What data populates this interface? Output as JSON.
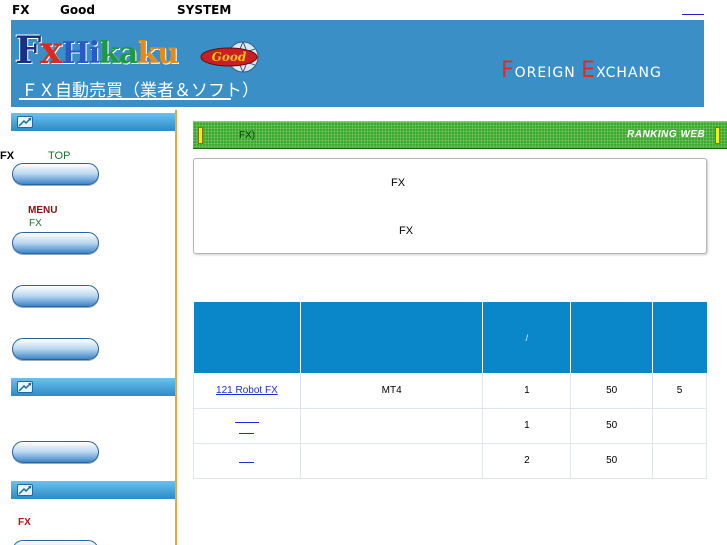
{
  "header": {
    "brand_left": "FX",
    "brand_mid": "Good",
    "brand_right": "SYSTEM"
  },
  "banner": {
    "logo_letters": [
      "F",
      "x",
      "Hi",
      "ka",
      "ku"
    ],
    "logo_badge": "Good",
    "logo_subtitle": "ＦＸ自動売買（業者＆ソフト）",
    "slogan_first_cap": "F",
    "slogan_first_rest": "OREIGN ",
    "slogan_second_cap": "E",
    "slogan_second_rest": "XCHANG"
  },
  "sidebar": {
    "fx_label": "FX",
    "top_label": "TOP",
    "menu_label": "MENU",
    "menu_sub": "FX",
    "bottom_label": "FX"
  },
  "main": {
    "ranking_title": "FX)",
    "ranking_tag": "RANKING WEB",
    "info_line1": "FX",
    "info_line2": "FX",
    "table": {
      "headers": [
        "",
        "",
        "/",
        "",
        ""
      ],
      "rows": [
        {
          "name": "121 Robot FX",
          "platform": "MT4",
          "col3": "1",
          "col4": "50",
          "col5": "5"
        },
        {
          "name": "",
          "platform": "",
          "col3": "1",
          "col4": "50",
          "col5": ""
        },
        {
          "name": "",
          "platform": "",
          "col3": "2",
          "col4": "50",
          "col5": ""
        }
      ]
    }
  },
  "colors": {
    "banner_bg": "#3a90c6",
    "table_header": "#0a87c9",
    "ranking_bar": "#3caa2c",
    "sidebar_border": "#f0a63c"
  }
}
